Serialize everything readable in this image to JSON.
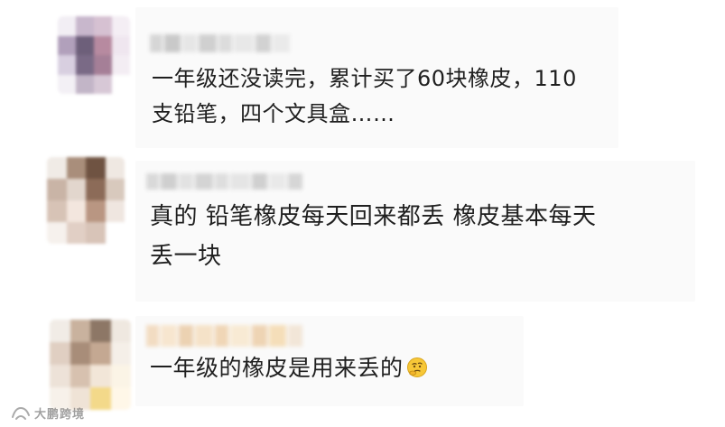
{
  "comments": [
    {
      "text_lines": [
        "一年级还没读完，累计买了60块橡皮，110",
        "支铅笔，四个文具盒……"
      ],
      "avatar_colors": [
        "#f2eef4",
        "#c8b7cc",
        "#d6c1d2",
        "#f4eef4",
        "#b1a0bb",
        "#6d5f7a",
        "#b78aa0",
        "#efe6ef",
        "#d8cfe0",
        "#7a6a86",
        "#a57f97",
        "#f3edf3",
        "#f3f0f5",
        "#c2b5c7",
        "#d7c8d6",
        "#ffffff"
      ],
      "name_colors": [
        "#d6d6d6",
        "#c9c9c9",
        "#e6e6e6",
        "#d0d0d0",
        "#dcdcdc",
        "#e8e8e8",
        "#d2d2d2",
        "#eaeaea"
      ]
    },
    {
      "text_lines": [
        "真的 铅笔橡皮每天回来都丢  橡皮基本每天",
        "丢一块"
      ],
      "avatar_colors": [
        "#f0ebe6",
        "#a98e7b",
        "#6f5342",
        "#efe8e2",
        "#c9b4a6",
        "#e2d6cd",
        "#8c6b58",
        "#d8c9bd",
        "#d7c3b6",
        "#f3e6de",
        "#b99682",
        "#efe6e0",
        "#f6f1ed",
        "#e1cfc5",
        "#d8c4b8",
        "#ffffff"
      ],
      "name_colors": [
        "#d9d9d9",
        "#cfcfcf",
        "#e2e2e2",
        "#d4d4d4",
        "#dedede",
        "#e5e5e5",
        "#d0d0d0",
        "#e9e9e9",
        "#d6d6d6"
      ]
    },
    {
      "text_lines": [
        "一年级的橡皮是用来丢的"
      ],
      "has_emoji": true,
      "emoji": "thinking-face",
      "avatar_colors": [
        "#f1ece6",
        "#c9b29e",
        "#8d7766",
        "#efe8e0",
        "#e0cfc2",
        "#a88d79",
        "#c4a892",
        "#f5efe8",
        "#ede2d8",
        "#d7c1af",
        "#f2e6d8",
        "#fbf4e6",
        "#f7f1ea",
        "#efe3d6",
        "#f3d98a",
        "#fff7e8"
      ],
      "name_colors": [
        "#f2dcc2",
        "#f7e6cf",
        "#ecd2b2",
        "#f5e2c8",
        "#f0d6b6",
        "#f8ead4",
        "#eed4b4",
        "#f5deb9",
        "#f2e6d8"
      ]
    }
  ],
  "watermark": {
    "text": "大鹏跨境",
    "logo": "watermark-logo"
  }
}
